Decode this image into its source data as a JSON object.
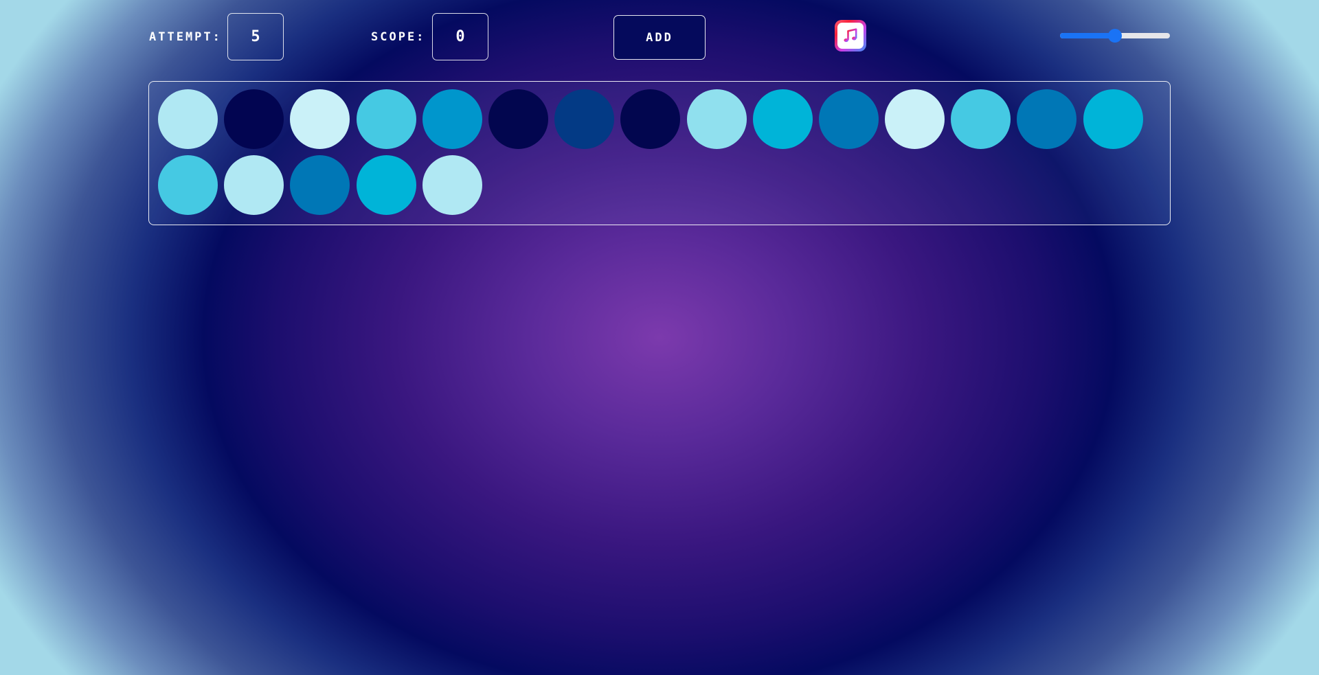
{
  "header": {
    "attempt_label": "ATTEMPT:",
    "attempt_value": "5",
    "score_label": "SCOPE:",
    "score_value": "0",
    "add_label": "ADD",
    "music_icon": "music-note-icon",
    "volume_level": 0.5
  },
  "colors": {
    "accent": "#1a73f5",
    "background_center": "#7c3aad",
    "background_ring": "#040a60",
    "background_edge": "#a3d8e8"
  },
  "balls": [
    "#b0e8f3",
    "#020551",
    "#caf1f8",
    "#45c9e3",
    "#0096cc",
    "#02064f",
    "#033a85",
    "#02064f",
    "#90e0ee",
    "#00b4d8",
    "#0077b6",
    "#caf1f8",
    "#45c9e3",
    "#0077b6",
    "#00b4d8",
    "#45c9e3",
    "#b0e8f3",
    "#0077b6",
    "#00b4d8",
    "#b0e8f3"
  ]
}
